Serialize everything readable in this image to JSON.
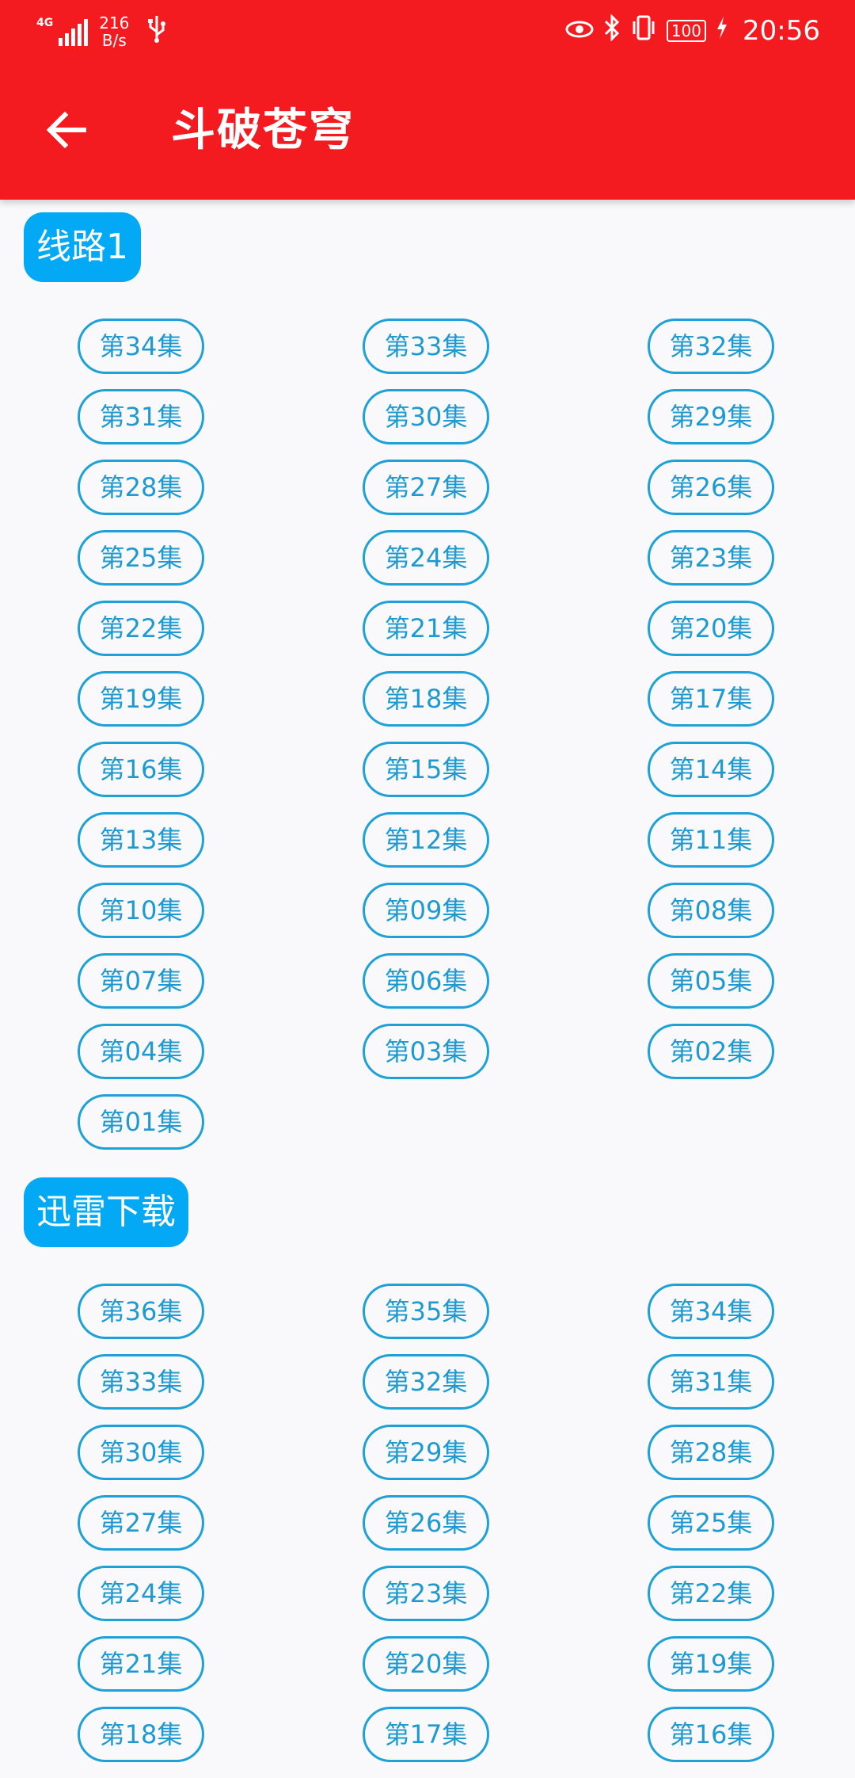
{
  "status_bar": {
    "network_type": "4G",
    "net_speed_value": "216",
    "net_speed_unit": "B/s",
    "usb_icon": "usb-icon",
    "eye_icon": "eye-comfort-icon",
    "bluetooth_icon": "bluetooth-icon",
    "vibrate_icon": "vibrate-icon",
    "battery": "100",
    "charging_icon": "charging-icon",
    "time": "20:56"
  },
  "toolbar": {
    "back_icon": "arrow-left-icon",
    "title": "斗破苍穹"
  },
  "colors": {
    "app_bar": "#f31b1f",
    "chip": "#03a9f4",
    "episode_border": "#1ea1d6",
    "episode_text": "#1f9ad0",
    "background": "#f9f9fb"
  },
  "sections": [
    {
      "label": "线路1",
      "episodes": [
        "第34集",
        "第33集",
        "第32集",
        "第31集",
        "第30集",
        "第29集",
        "第28集",
        "第27集",
        "第26集",
        "第25集",
        "第24集",
        "第23集",
        "第22集",
        "第21集",
        "第20集",
        "第19集",
        "第18集",
        "第17集",
        "第16集",
        "第15集",
        "第14集",
        "第13集",
        "第12集",
        "第11集",
        "第10集",
        "第09集",
        "第08集",
        "第07集",
        "第06集",
        "第05集",
        "第04集",
        "第03集",
        "第02集",
        "第01集"
      ]
    },
    {
      "label": "迅雷下载",
      "episodes": [
        "第36集",
        "第35集",
        "第34集",
        "第33集",
        "第32集",
        "第31集",
        "第30集",
        "第29集",
        "第28集",
        "第27集",
        "第26集",
        "第25集",
        "第24集",
        "第23集",
        "第22集",
        "第21集",
        "第20集",
        "第19集",
        "第18集",
        "第17集",
        "第16集"
      ]
    }
  ]
}
